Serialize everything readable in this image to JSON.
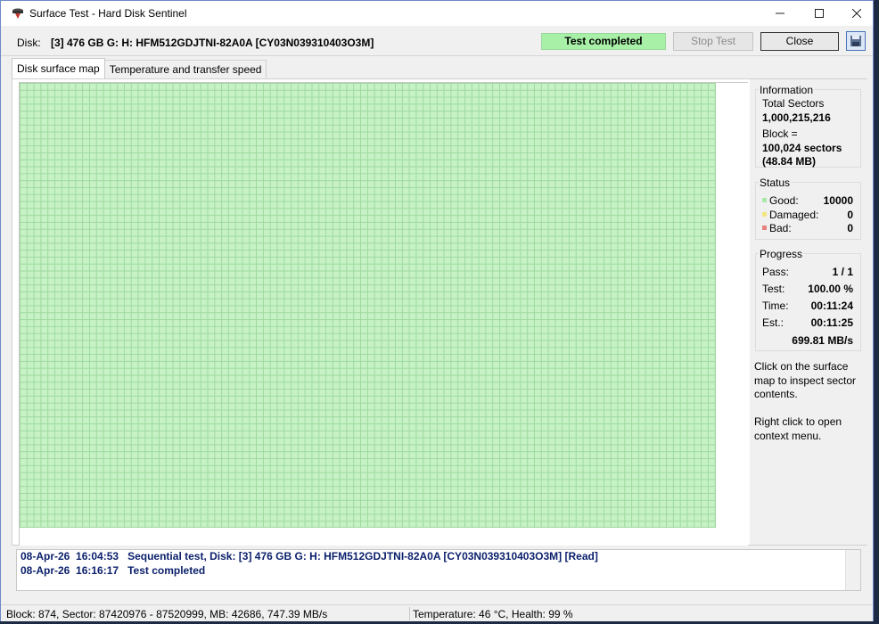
{
  "window": {
    "title": "Surface Test - Hard Disk Sentinel",
    "app_icon": "hdd-sentinel-icon"
  },
  "disk": {
    "label": "Disk:",
    "value": "[3] 476 GB G: H: HFM512GDJTNI-82A0A [CY03N039310403O3M]"
  },
  "status_pill": "Test completed",
  "buttons": {
    "stop": "Stop Test",
    "close": "Close",
    "save_icon": "save-icon"
  },
  "tabs": [
    {
      "label": "Disk surface map",
      "active": true
    },
    {
      "label": "Temperature and transfer speed",
      "active": false
    }
  ],
  "map": {
    "good_color": "#c6f2c6",
    "block_state": "all good"
  },
  "info": {
    "title": "Information",
    "total_sectors_label": "Total Sectors",
    "total_sectors": "1,000,215,216",
    "block_label": "Block =",
    "block_sectors": "100,024 sectors",
    "block_mb": "(48.84 MB)"
  },
  "status": {
    "title": "Status",
    "good_label": "Good:",
    "good_value": "10000",
    "good_color": "#a8e8a8",
    "damaged_label": "Damaged:",
    "damaged_value": "0",
    "damaged_color": "#f2e680",
    "bad_label": "Bad:",
    "bad_value": "0",
    "bad_color": "#e88080"
  },
  "progress": {
    "title": "Progress",
    "pass_label": "Pass:",
    "pass_value": "1 / 1",
    "test_label": "Test:",
    "test_value": "100.00 %",
    "time_label": "Time:",
    "time_value": "00:11:24",
    "est_label": "Est.:",
    "est_value": "00:11:25",
    "speed": "699.81 MB/s"
  },
  "help": {
    "line1": "Click on the surface map to inspect sector contents.",
    "line2": "Right click to open context menu."
  },
  "log": [
    {
      "date": "08-Apr-26",
      "time": "16:04:53",
      "message": "Sequential test, Disk: [3] 476 GB G: H: HFM512GDJTNI-82A0A [CY03N039310403O3M] [Read]"
    },
    {
      "date": "08-Apr-26",
      "time": "16:16:17",
      "message": "Test completed"
    }
  ],
  "statusbar": {
    "left": "Block: 874, Sector: 87420976 - 87520999, MB: 42686, 747.39 MB/s",
    "right": "Temperature: 46  °C,  Health: 99 %"
  }
}
